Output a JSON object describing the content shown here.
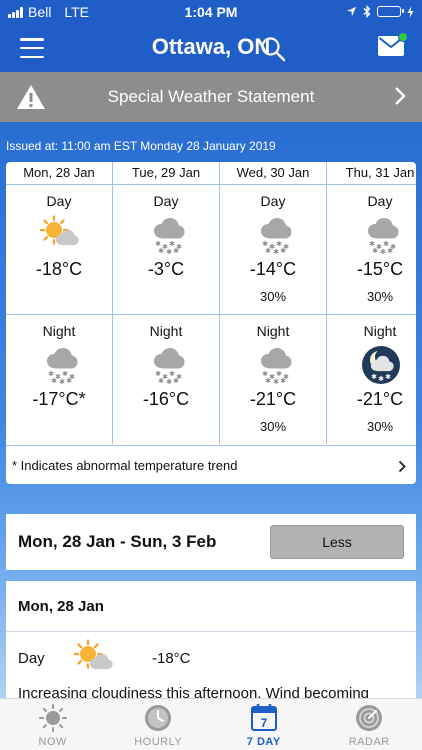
{
  "status_bar": {
    "carrier": "Bell",
    "network": "LTE",
    "time": "1:04 PM"
  },
  "header": {
    "city": "Ottawa, ON"
  },
  "banner": {
    "text": "Special Weather Statement"
  },
  "issued": "Issued at: 11:00 am EST Monday 28 January 2019",
  "forecast": {
    "days": [
      {
        "header": "Mon, 28 Jan",
        "day": {
          "period": "Day",
          "icon": "sun-cloud-icon",
          "temp": "-18°C",
          "pop": ""
        },
        "night": {
          "period": "Night",
          "icon": "cloud-snow-icon",
          "temp": "-17°C*",
          "pop": ""
        }
      },
      {
        "header": "Tue, 29 Jan",
        "day": {
          "period": "Day",
          "icon": "cloud-snow-icon",
          "temp": "-3°C",
          "pop": ""
        },
        "night": {
          "period": "Night",
          "icon": "cloud-snow-icon",
          "temp": "-16°C",
          "pop": ""
        }
      },
      {
        "header": "Wed, 30 Jan",
        "day": {
          "period": "Day",
          "icon": "cloud-snow-icon",
          "temp": "-14°C",
          "pop": "30%"
        },
        "night": {
          "period": "Night",
          "icon": "cloud-snow-icon",
          "temp": "-21°C",
          "pop": "30%"
        }
      },
      {
        "header": "Thu, 31 Jan",
        "day": {
          "period": "Day",
          "icon": "cloud-snow-icon",
          "temp": "-15°C",
          "pop": "30%"
        },
        "night": {
          "period": "Night",
          "icon": "moon-snow-icon",
          "temp": "-21°C",
          "pop": "30%"
        }
      }
    ],
    "note": "* Indicates abnormal temperature trend"
  },
  "week": {
    "range": "Mon, 28 Jan - Sun, 3 Feb",
    "toggle_label": "Less"
  },
  "detail": {
    "title": "Mon, 28 Jan",
    "period": "Day",
    "icon": "sun-cloud-icon",
    "temp": "-18°C",
    "text": "Increasing cloudiness this afternoon. Wind becoming"
  },
  "tabs": [
    {
      "label": "NOW",
      "icon": "sun-icon",
      "active": false
    },
    {
      "label": "HOURLY",
      "icon": "clock-icon",
      "active": false
    },
    {
      "label": "7 DAY",
      "icon": "calendar-icon",
      "active": true
    },
    {
      "label": "RADAR",
      "icon": "radar-icon",
      "active": false
    }
  ],
  "colors": {
    "brand": "#1f5ec6",
    "banner": "#8d8d8d",
    "grid_line": "#9ec3e8",
    "notification": "#2ecc40"
  }
}
